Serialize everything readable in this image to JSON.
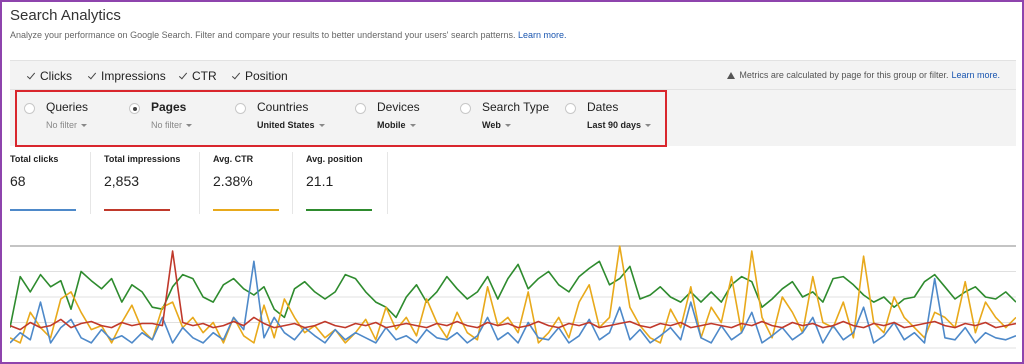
{
  "header": {
    "title": "Search Analytics",
    "subtitle": "Analyze your performance on Google Search. Filter and compare your results to better understand your users' search patterns.",
    "learn_more": "Learn more."
  },
  "metrics_toggles": [
    {
      "label": "Clicks",
      "checked": true
    },
    {
      "label": "Impressions",
      "checked": true
    },
    {
      "label": "CTR",
      "checked": true
    },
    {
      "label": "Position",
      "checked": true
    }
  ],
  "note": {
    "text": "Metrics are calculated by page for this group or filter.",
    "link": "Learn more."
  },
  "dimensions": [
    {
      "label": "Queries",
      "value": "No filter",
      "selected": false
    },
    {
      "label": "Pages",
      "value": "No filter",
      "selected": true
    },
    {
      "label": "Countries",
      "value": "United States",
      "selected": false
    },
    {
      "label": "Devices",
      "value": "Mobile",
      "selected": false
    },
    {
      "label": "Search Type",
      "value": "Web",
      "selected": false
    },
    {
      "label": "Dates",
      "value": "Last 90 days",
      "selected": false
    }
  ],
  "stats": [
    {
      "label": "Total clicks",
      "value": "68",
      "color": "#4e89c9"
    },
    {
      "label": "Total impressions",
      "value": "2,853",
      "color": "#c0392b"
    },
    {
      "label": "Avg. CTR",
      "value": "2.38%",
      "color": "#e8a91b"
    },
    {
      "label": "Avg. position",
      "value": "21.1",
      "color": "#2e8b2e"
    }
  ],
  "chart_data": {
    "type": "line",
    "grid": true,
    "ylim": [
      0,
      100
    ],
    "series": [
      {
        "color": "#2e8b2e",
        "values": [
          20,
          70,
          55,
          72,
          60,
          66,
          38,
          75,
          66,
          58,
          68,
          45,
          62,
          55,
          40,
          38,
          60,
          72,
          68,
          50,
          45,
          62,
          68,
          58,
          52,
          60,
          38,
          30,
          58,
          65,
          55,
          48,
          55,
          72,
          68,
          55,
          45,
          40,
          30,
          50,
          62,
          45,
          55,
          70,
          58,
          48,
          55,
          70,
          48,
          68,
          82,
          58,
          68,
          75,
          62,
          55,
          70,
          78,
          85,
          62,
          68,
          80,
          48,
          52,
          60,
          50,
          45,
          55,
          45,
          55,
          45,
          62,
          70,
          65,
          40,
          48,
          58,
          65,
          50,
          55,
          45,
          68,
          70,
          62,
          52,
          45,
          50,
          40,
          48,
          50,
          65,
          72,
          60,
          48,
          55,
          60,
          50,
          48,
          55,
          45
        ]
      },
      {
        "color": "#e8a91b",
        "values": [
          10,
          5,
          35,
          20,
          10,
          48,
          55,
          35,
          18,
          22,
          5,
          25,
          42,
          18,
          8,
          40,
          45,
          20,
          30,
          15,
          25,
          5,
          30,
          12,
          5,
          42,
          10,
          48,
          30,
          15,
          22,
          10,
          18,
          5,
          15,
          28,
          8,
          40,
          18,
          30,
          12,
          48,
          25,
          10,
          35,
          15,
          8,
          60,
          22,
          30,
          15,
          55,
          5,
          15,
          30,
          10,
          45,
          62,
          20,
          30,
          100,
          40,
          22,
          10,
          5,
          38,
          20,
          60,
          10,
          40,
          25,
          70,
          15,
          95,
          30,
          10,
          50,
          35,
          15,
          70,
          25,
          20,
          45,
          10,
          90,
          25,
          15,
          50,
          30,
          20,
          10,
          35,
          30,
          20,
          65,
          15,
          45,
          30,
          20,
          30
        ]
      },
      {
        "color": "#4e89c9",
        "values": [
          5,
          15,
          8,
          45,
          5,
          20,
          28,
          10,
          5,
          18,
          8,
          12,
          5,
          15,
          8,
          30,
          5,
          20,
          10,
          5,
          15,
          8,
          30,
          18,
          85,
          10,
          30,
          15,
          8,
          20,
          12,
          5,
          18,
          8,
          15,
          10,
          5,
          20,
          8,
          12,
          5,
          18,
          10,
          8,
          15,
          5,
          12,
          30,
          8,
          15,
          5,
          25,
          10,
          8,
          20,
          5,
          12,
          28,
          8,
          15,
          40,
          8,
          18,
          5,
          12,
          20,
          8,
          45,
          10,
          5,
          22,
          8,
          15,
          35,
          5,
          12,
          20,
          8,
          15,
          30,
          5,
          22,
          8,
          15,
          40,
          5,
          12,
          25,
          8,
          15,
          5,
          68,
          10,
          8,
          20,
          5,
          15,
          10,
          8,
          12
        ]
      },
      {
        "color": "#c0392b",
        "values": [
          22,
          18,
          25,
          20,
          22,
          28,
          20,
          24,
          26,
          22,
          20,
          25,
          22,
          24,
          24,
          22,
          95,
          25,
          22,
          24,
          20,
          22,
          26,
          22,
          30,
          24,
          20,
          22,
          24,
          20,
          22,
          26,
          22,
          20,
          24,
          22,
          25,
          20,
          22,
          24,
          22,
          20,
          24,
          22,
          26,
          22,
          20,
          25,
          22,
          24,
          20,
          22,
          26,
          22,
          20,
          24,
          22,
          25,
          20,
          22,
          24,
          26,
          22,
          20,
          24,
          22,
          25,
          20,
          22,
          24,
          22,
          20,
          24,
          22,
          26,
          22,
          20,
          25,
          22,
          24,
          20,
          22,
          26,
          22,
          20,
          24,
          22,
          25,
          20,
          22,
          24,
          26,
          22,
          20,
          24,
          22,
          25,
          20,
          22,
          24
        ]
      }
    ]
  }
}
